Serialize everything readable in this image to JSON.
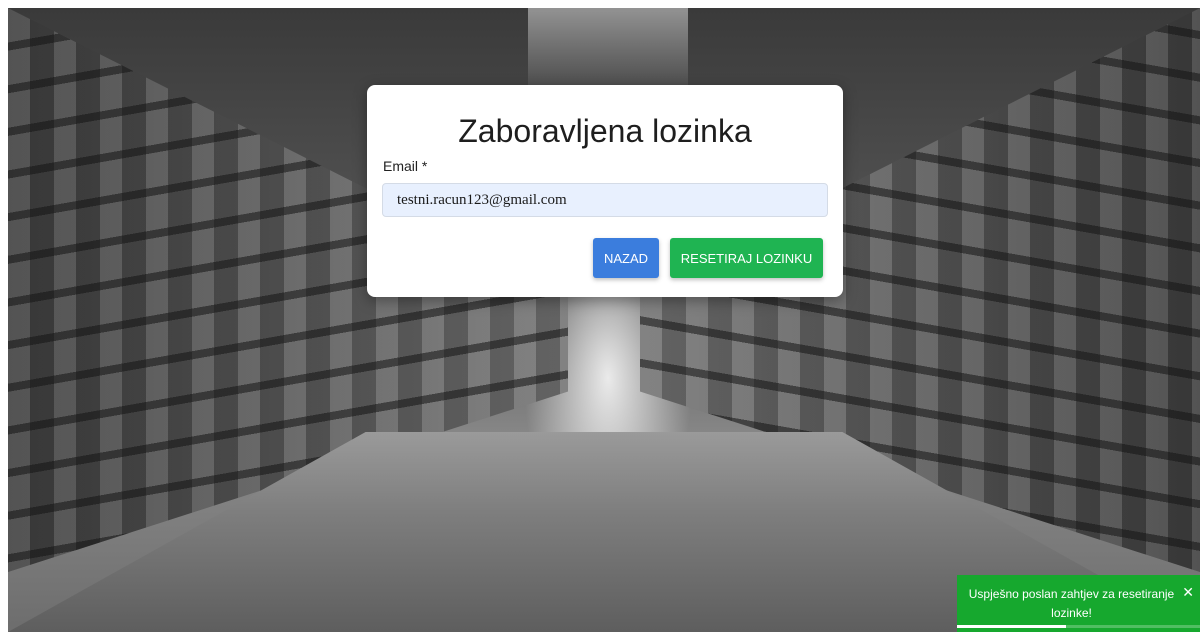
{
  "form": {
    "title": "Zaboravljena lozinka",
    "email_label": "Email *",
    "email_value": "testni.racun123@gmail.com",
    "back_label": "NAZAD",
    "reset_label": "RESETIRAJ LOZINKU"
  },
  "toast": {
    "message": "Uspješno poslan zahtjev za resetiranje lozinke!",
    "close_icon": "close-icon",
    "progress": 0.45
  },
  "colors": {
    "back_button": "#3b7ddd",
    "reset_button": "#1fb452",
    "toast_background": "#16a82e",
    "input_background": "#e8f0fe"
  }
}
